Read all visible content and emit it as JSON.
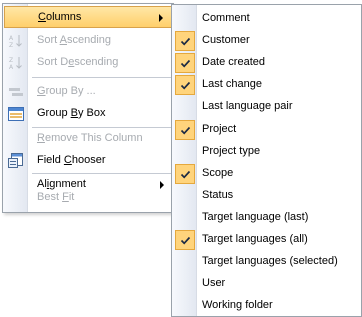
{
  "context_menu": {
    "items": [
      {
        "label": "Columns",
        "mnemonic": "C"
      },
      {
        "label": "Sort Ascending",
        "mnemonic": "A"
      },
      {
        "label": "Sort Descending",
        "mnemonic": "e"
      },
      {
        "label": "Group By ...",
        "mnemonic": "G"
      },
      {
        "label": "Group By Box",
        "mnemonic": "B"
      },
      {
        "label": "Remove This Column",
        "mnemonic": "R"
      },
      {
        "label": "Field Chooser",
        "mnemonic": "C"
      },
      {
        "label": "Alignment",
        "mnemonic": "i"
      },
      {
        "label": "Best Fit",
        "mnemonic": "F"
      }
    ]
  },
  "columns_submenu": {
    "items": [
      {
        "label": "Comment",
        "checked": false
      },
      {
        "label": "Customer",
        "checked": true
      },
      {
        "label": "Date created",
        "checked": true
      },
      {
        "label": "Last change",
        "checked": true
      },
      {
        "label": "Last language pair",
        "checked": false
      },
      {
        "label": "Project",
        "checked": true
      },
      {
        "label": "Project type",
        "checked": false
      },
      {
        "label": "Scope",
        "checked": true
      },
      {
        "label": "Status",
        "checked": false
      },
      {
        "label": "Target language (last)",
        "checked": false
      },
      {
        "label": "Target languages (all)",
        "checked": true
      },
      {
        "label": "Target languages (selected)",
        "checked": false
      },
      {
        "label": "User",
        "checked": false
      },
      {
        "label": "Working folder",
        "checked": false
      }
    ]
  },
  "colors": {
    "highlight": "#ffcf6b",
    "check_background": "#ffd47c",
    "disabled_text": "#a7abb0",
    "border": "#9aa2ab"
  },
  "icons": {
    "sort_ascending": "sort-ascending-icon",
    "sort_descending": "sort-descending-icon",
    "group_by": "group-by-icon",
    "group_by_box": "group-by-box-icon",
    "field_chooser": "field-chooser-icon",
    "check": "checkmark-icon",
    "submenu": "chevron-right-icon"
  }
}
